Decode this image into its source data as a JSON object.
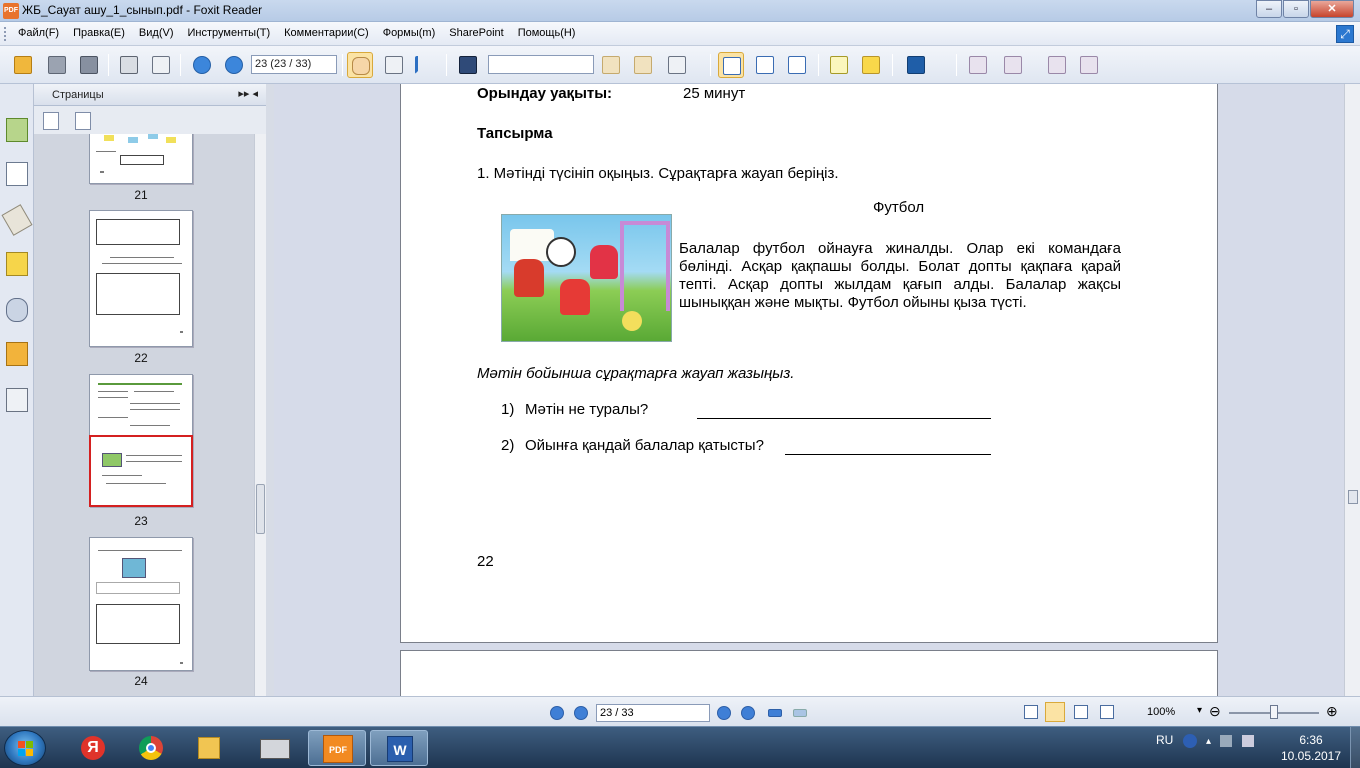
{
  "window": {
    "title": "ЖБ_Сауат ашу_1_сынып.pdf - Foxit Reader",
    "app_icon_text": "PDF",
    "buttons": [
      "–",
      "▫",
      "✕"
    ]
  },
  "menu": [
    "Файл(F)",
    "Правка(E)",
    "Вид(V)",
    "Инструменты(T)",
    "Комментарии(C)",
    "Формы(m)",
    "SharePoint",
    "Помощь(H)"
  ],
  "toolbar": {
    "page_field": "23 (23 / 33)",
    "search_value": ""
  },
  "icons": {
    "open": "open-folder-icon",
    "save": "save-icon",
    "print": "print-icon",
    "hand": "hand-tool-icon",
    "select": "select-arrow-icon",
    "find": "binoculars-icon"
  },
  "pages_panel": {
    "title": "Страницы",
    "collapse": "▸▸ ◂",
    "thumbnails": [
      {
        "label": "21"
      },
      {
        "label": "22"
      },
      {
        "label": "23"
      },
      {
        "label": "24"
      }
    ]
  },
  "document": {
    "time_label": "Орындау уақыты:",
    "time_value": "25 минут",
    "task_heading": "Тапсырма",
    "instruction": "1. Мәтінді түсініп оқыңыз. Сұрақтарға жауап беріңіз.",
    "story_title": "Футбол",
    "story_text": "Балалар футбол ойнауға жиналды. Олар екі командаға бөлінді. Асқар қақпашы болды. Болат допты қақпаға қарай тепті. Асқар допты жылдам  қағып алды. Балалар жақсы шыныққан және мықты. Футбол ойыны қыза түсті.",
    "questions_prompt": "Мәтін бойынша сұрақтарға жауап жазыңыз.",
    "questions": [
      {
        "num": "1)",
        "text": "Мәтін не туралы?"
      },
      {
        "num": "2)",
        "text": "Ойынға қандай балалар қатысты?"
      }
    ],
    "page_number": "22"
  },
  "statusbar": {
    "page_nav": "23 / 33",
    "zoom": "100%"
  },
  "taskbar": {
    "lang": "RU",
    "time": "6:36",
    "date": "10.05.2017"
  },
  "colors": {
    "accent": "#3f7fd6",
    "highlight_border": "#d42020",
    "taskbar": "#1e3550"
  }
}
